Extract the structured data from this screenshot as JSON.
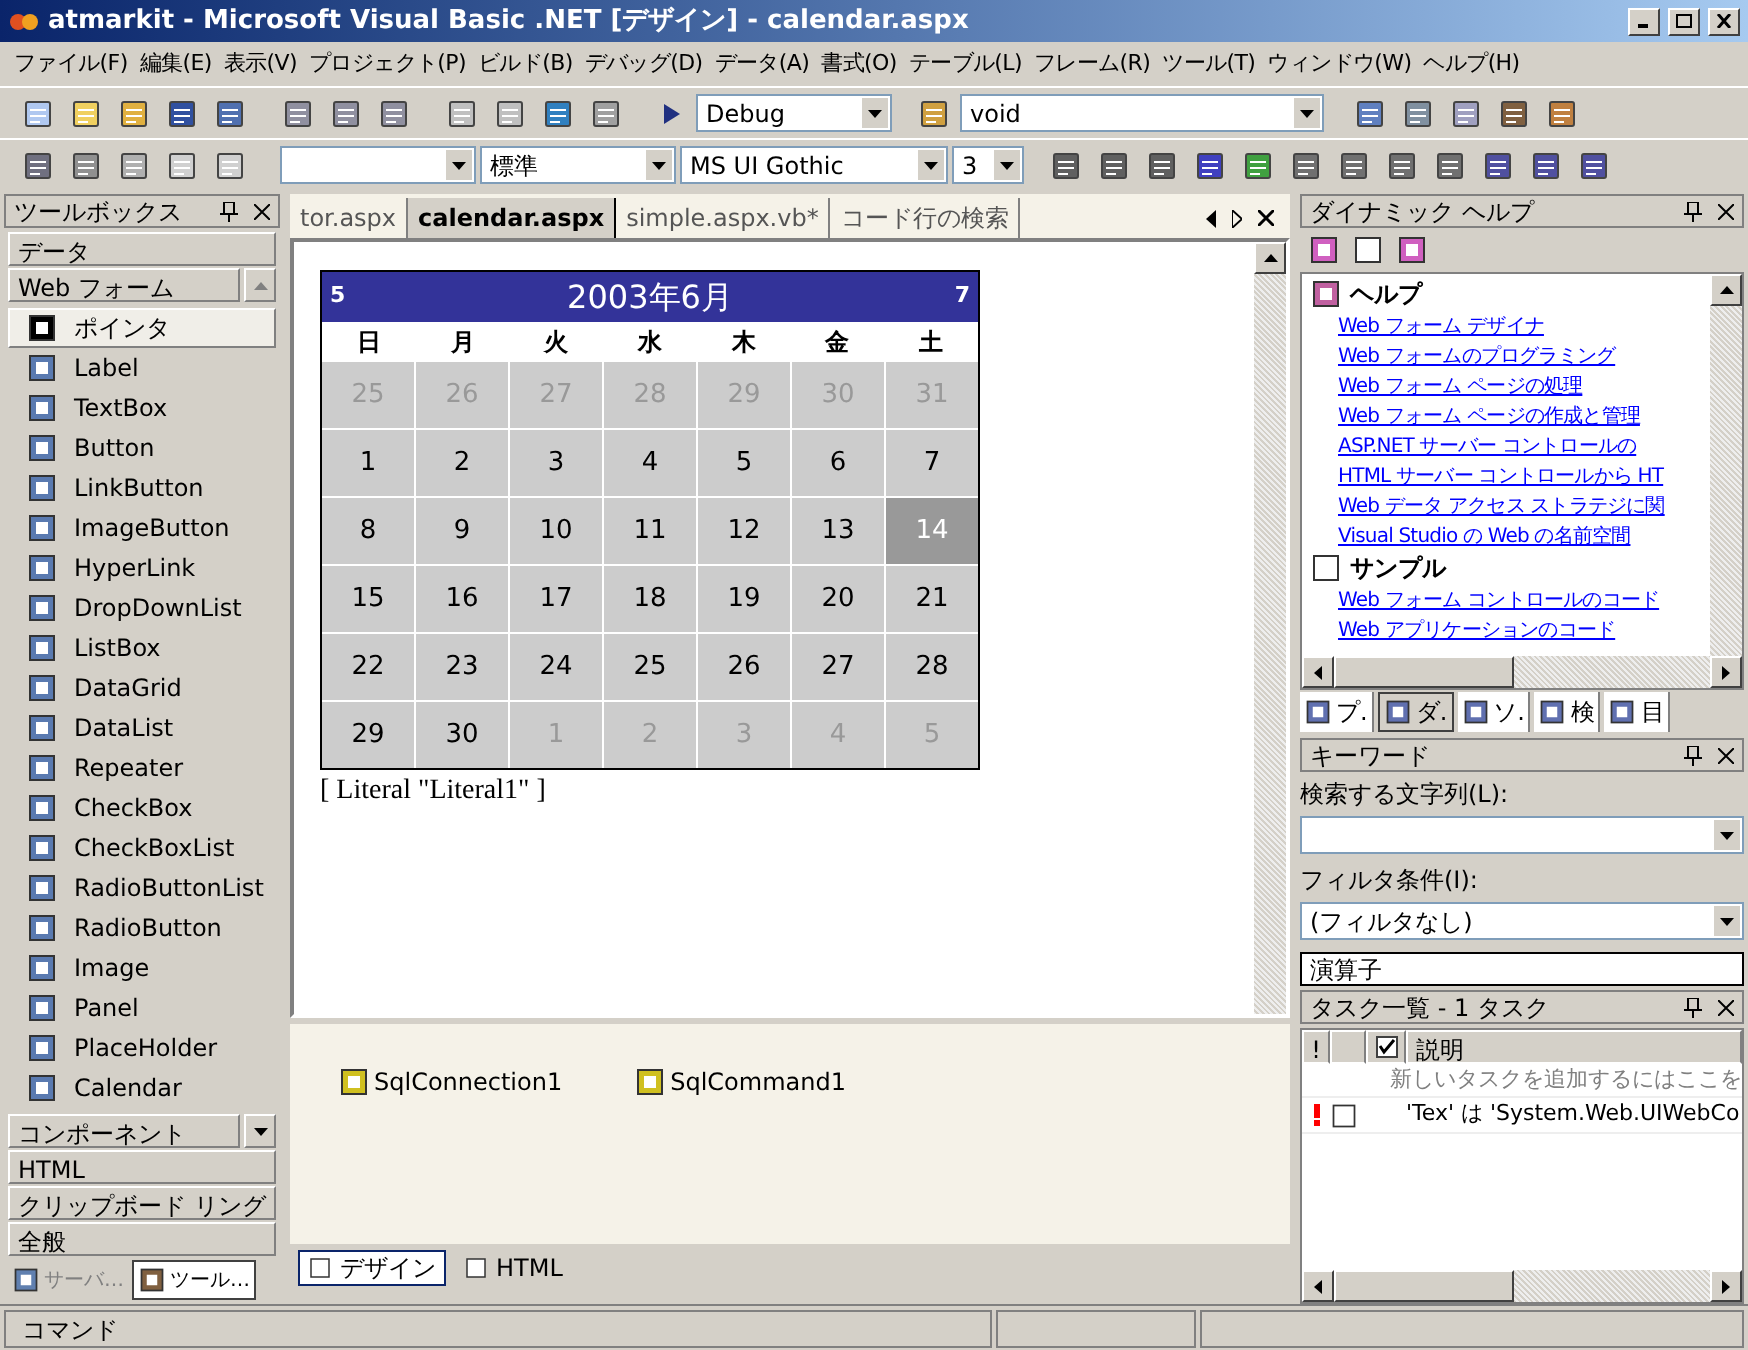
{
  "window": {
    "title": "atmarkit - Microsoft Visual Basic .NET [デザイン] - calendar.aspx"
  },
  "menu": [
    "ファイル(F)",
    "編集(E)",
    "表示(V)",
    "プロジェクト(P)",
    "ビルド(B)",
    "デバッグ(D)",
    "データ(A)",
    "書式(O)",
    "テーブル(L)",
    "フレーム(R)",
    "ツール(T)",
    "ウィンドウ(W)",
    "ヘルプ(H)"
  ],
  "toolbar": {
    "configuration": "Debug",
    "object": "void",
    "font_style": "標準",
    "font_name": "MS UI Gothic",
    "font_size": "3"
  },
  "toolbox": {
    "title": "ツールボックス",
    "sections_top": [
      "データ"
    ],
    "active_section": "Web フォーム",
    "items": [
      {
        "label": "ポインタ",
        "selected": true
      },
      {
        "label": "Label",
        "selected": false
      },
      {
        "label": "TextBox",
        "selected": false
      },
      {
        "label": "Button",
        "selected": false
      },
      {
        "label": "LinkButton",
        "selected": false
      },
      {
        "label": "ImageButton",
        "selected": false
      },
      {
        "label": "HyperLink",
        "selected": false
      },
      {
        "label": "DropDownList",
        "selected": false
      },
      {
        "label": "ListBox",
        "selected": false
      },
      {
        "label": "DataGrid",
        "selected": false
      },
      {
        "label": "DataList",
        "selected": false
      },
      {
        "label": "Repeater",
        "selected": false
      },
      {
        "label": "CheckBox",
        "selected": false
      },
      {
        "label": "CheckBoxList",
        "selected": false
      },
      {
        "label": "RadioButtonList",
        "selected": false
      },
      {
        "label": "RadioButton",
        "selected": false
      },
      {
        "label": "Image",
        "selected": false
      },
      {
        "label": "Panel",
        "selected": false
      },
      {
        "label": "PlaceHolder",
        "selected": false
      },
      {
        "label": "Calendar",
        "selected": false
      }
    ],
    "sections_bottom": [
      "コンポーネント",
      "HTML",
      "クリップボード リング",
      "全般"
    ],
    "tabs": [
      {
        "label": "サーバ…",
        "selected": false
      },
      {
        "label": "ツール…",
        "selected": true
      }
    ]
  },
  "document_tabs": [
    {
      "label": "tor.aspx",
      "selected": false
    },
    {
      "label": "calendar.aspx",
      "selected": true
    },
    {
      "label": "simple.aspx.vb*",
      "selected": false
    },
    {
      "label": "コード行の検索",
      "selected": false
    }
  ],
  "calendar": {
    "title": "2003年6月",
    "prev": "5",
    "next": "7",
    "weekdays": [
      "日",
      "月",
      "火",
      "水",
      "木",
      "金",
      "土"
    ],
    "weeks": [
      [
        {
          "day": "25",
          "kind": "other",
          "selected": false
        },
        {
          "day": "26",
          "kind": "other",
          "selected": false
        },
        {
          "day": "27",
          "kind": "other",
          "selected": false
        },
        {
          "day": "28",
          "kind": "other",
          "selected": false
        },
        {
          "day": "29",
          "kind": "other",
          "selected": false
        },
        {
          "day": "30",
          "kind": "other",
          "selected": false
        },
        {
          "day": "31",
          "kind": "other",
          "selected": false
        }
      ],
      [
        {
          "day": "1",
          "kind": "current",
          "selected": false
        },
        {
          "day": "2",
          "kind": "current",
          "selected": false
        },
        {
          "day": "3",
          "kind": "current",
          "selected": false
        },
        {
          "day": "4",
          "kind": "current",
          "selected": false
        },
        {
          "day": "5",
          "kind": "current",
          "selected": false
        },
        {
          "day": "6",
          "kind": "current",
          "selected": false
        },
        {
          "day": "7",
          "kind": "current",
          "selected": false
        }
      ],
      [
        {
          "day": "8",
          "kind": "current",
          "selected": false
        },
        {
          "day": "9",
          "kind": "current",
          "selected": false
        },
        {
          "day": "10",
          "kind": "current",
          "selected": false
        },
        {
          "day": "11",
          "kind": "current",
          "selected": false
        },
        {
          "day": "12",
          "kind": "current",
          "selected": false
        },
        {
          "day": "13",
          "kind": "current",
          "selected": false
        },
        {
          "day": "14",
          "kind": "current",
          "selected": true
        }
      ],
      [
        {
          "day": "15",
          "kind": "current",
          "selected": false
        },
        {
          "day": "16",
          "kind": "current",
          "selected": false
        },
        {
          "day": "17",
          "kind": "current",
          "selected": false
        },
        {
          "day": "18",
          "kind": "current",
          "selected": false
        },
        {
          "day": "19",
          "kind": "current",
          "selected": false
        },
        {
          "day": "20",
          "kind": "current",
          "selected": false
        },
        {
          "day": "21",
          "kind": "current",
          "selected": false
        }
      ],
      [
        {
          "day": "22",
          "kind": "current",
          "selected": false
        },
        {
          "day": "23",
          "kind": "current",
          "selected": false
        },
        {
          "day": "24",
          "kind": "current",
          "selected": false
        },
        {
          "day": "25",
          "kind": "current",
          "selected": false
        },
        {
          "day": "26",
          "kind": "current",
          "selected": false
        },
        {
          "day": "27",
          "kind": "current",
          "selected": false
        },
        {
          "day": "28",
          "kind": "current",
          "selected": false
        }
      ],
      [
        {
          "day": "29",
          "kind": "current",
          "selected": false
        },
        {
          "day": "30",
          "kind": "current",
          "selected": false
        },
        {
          "day": "1",
          "kind": "other",
          "selected": false
        },
        {
          "day": "2",
          "kind": "other",
          "selected": false
        },
        {
          "day": "3",
          "kind": "other",
          "selected": false
        },
        {
          "day": "4",
          "kind": "other",
          "selected": false
        },
        {
          "day": "5",
          "kind": "other",
          "selected": false
        }
      ]
    ]
  },
  "literal": "[ Literal \"Literal1\" ]",
  "components": [
    "SqlConnection1",
    "SqlCommand1"
  ],
  "view_tabs": [
    {
      "label": "デザイン",
      "selected": true
    },
    {
      "label": "HTML",
      "selected": false
    }
  ],
  "dynamic_help": {
    "title": "ダイナミック ヘルプ",
    "sections": [
      {
        "heading": "ヘルプ",
        "links": [
          "Web フォーム デザイナ",
          "Web フォームのプログラミング",
          "Web フォーム ページの処理",
          "Web フォーム ページの作成と管理",
          "ASP.NET サーバー コントロールの",
          "HTML サーバー コントロールから HT",
          "Web データ アクセス ストラテジに関",
          "Visual Studio の Web の名前空間"
        ]
      },
      {
        "heading": "サンプル",
        "links": [
          "Web フォーム コントロールのコード",
          "Web アプリケーションのコード"
        ]
      }
    ],
    "tabs": [
      {
        "label": "プ.",
        "selected": false
      },
      {
        "label": "ダ.",
        "selected": true
      },
      {
        "label": "ソ.",
        "selected": false
      },
      {
        "label": "検",
        "selected": false
      },
      {
        "label": "目",
        "selected": false
      }
    ]
  },
  "keyword": {
    "title": "キーワード",
    "search_label": "検索する文字列(L):",
    "filter_label": "フィルタ条件(I):",
    "filter_value": "(フィルタなし)",
    "list_item": "演算子"
  },
  "task_list": {
    "title": "タスク一覧 - 1 タスク",
    "columns": [
      "!",
      "説明"
    ],
    "new_task_hint": "新しいタスクを追加するにはここを",
    "tasks": [
      {
        "description": "'Tex' は 'System.Web.UIWebCo"
      }
    ]
  },
  "status_bar": {
    "text": "コマンド"
  }
}
